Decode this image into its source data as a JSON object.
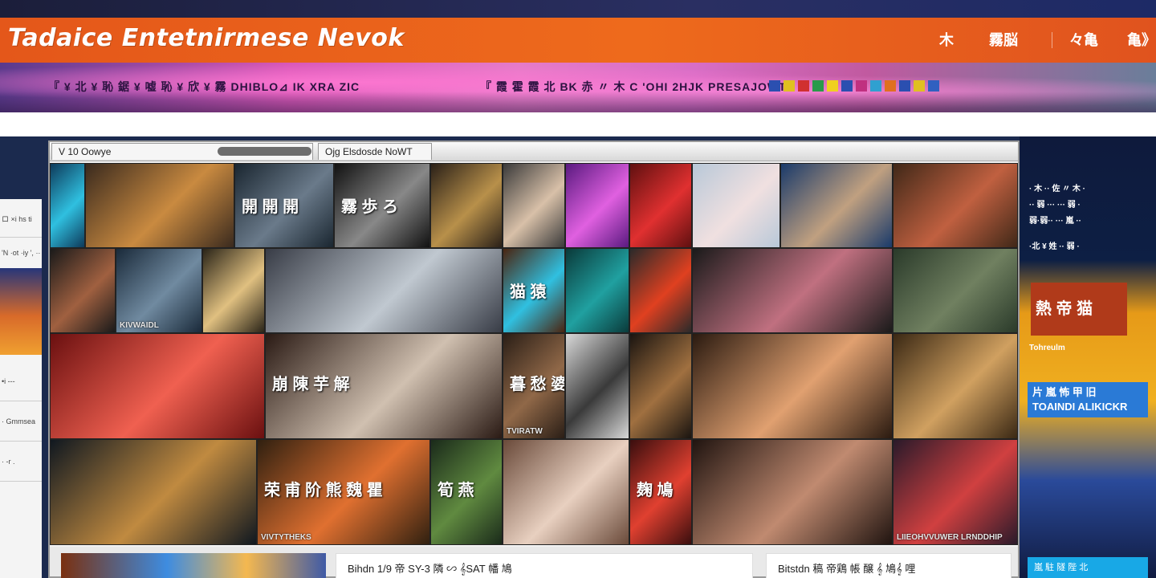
{
  "header": {
    "title": "Tadaice  Entetnirmese Nevok",
    "nav": [
      {
        "label": "木",
        "icon": "star-icon"
      },
      {
        "label": "霧脳",
        "icon": null
      },
      {
        "label": "々亀",
        "icon": null
      },
      {
        "label": "亀》",
        "icon": null
      }
    ]
  },
  "banner": {
    "text_left": "『 ¥ 北 ¥ 恥 鋸 ¥ 嘘 恥 ¥ 欣 ¥ 霧 DHIBLO⊿ IK XRA ZIC",
    "text_right": "『 霞 霍 霞 北 BK 赤 〃 木 C 'OHI 2HJK PRESAJOWT",
    "flag_colors": [
      "#2b4fb0",
      "#e0c020",
      "#d03030",
      "#2a9a4a",
      "#f0d020",
      "#2b4fb0",
      "#c03080",
      "#30a0d0",
      "#e07020",
      "#2b4fb0",
      "#e0c020",
      "#3060c0"
    ]
  },
  "left_panel": {
    "items": [
      "ロ ×i hs ti",
      "'N ·ot ·iy ', ··",
      "•i  ---",
      "·  Gmmsea",
      "·  -r  ."
    ]
  },
  "window": {
    "tabs": [
      {
        "label": "V  10   Oowye"
      },
      {
        "label": "Ojg  Elsdosde NoWT"
      }
    ],
    "progress": 0.78,
    "tiles": [
      {
        "caption": "",
        "big": "",
        "colors": [
          "#0e3a5a",
          "#2fc0e0"
        ]
      },
      {
        "caption": "",
        "big": "",
        "colors": [
          "#3a2a1e",
          "#c98a40"
        ]
      },
      {
        "caption": "",
        "big": "開 開 開",
        "colors": [
          "#1a2630",
          "#6a7a8a"
        ]
      },
      {
        "caption": "",
        "big": "霧 歩 ろ",
        "colors": [
          "#111",
          "#888"
        ]
      },
      {
        "caption": "",
        "big": "",
        "colors": [
          "#2a2018",
          "#b8904a"
        ]
      },
      {
        "caption": "",
        "big": "",
        "colors": [
          "#3a3a3a",
          "#d8c0a8"
        ]
      },
      {
        "caption": "",
        "big": "",
        "colors": [
          "#5a1a80",
          "#e060e0"
        ]
      },
      {
        "caption": "",
        "big": "",
        "colors": [
          "#601010",
          "#e03030"
        ]
      },
      {
        "caption": "",
        "big": "",
        "colors": [
          "#b8c8d8",
          "#f0e0e0"
        ]
      },
      {
        "caption": "",
        "big": "",
        "colors": [
          "#1a3a6a",
          "#c0a080"
        ]
      },
      {
        "caption": "",
        "big": "",
        "colors": [
          "#402818",
          "#c06040"
        ]
      },
      {
        "caption": "",
        "big": "",
        "colors": [
          "#1a1a1a",
          "#a06040"
        ]
      },
      {
        "caption": "KIVWAIDL",
        "big": "",
        "colors": [
          "#1a2a3a",
          "#708aa0"
        ]
      },
      {
        "caption": "",
        "big": "",
        "colors": [
          "#2a2418",
          "#e0c080"
        ]
      },
      {
        "caption": "",
        "big": "",
        "colors": [
          "#383c46",
          "#c0c8d0"
        ]
      },
      {
        "caption": "",
        "big": "猫 猿",
        "colors": [
          "#4a2410",
          "#30c0e0"
        ]
      },
      {
        "caption": "",
        "big": "",
        "colors": [
          "#0a3a3a",
          "#20a0a0"
        ]
      },
      {
        "caption": "",
        "big": "",
        "colors": [
          "#2a2a2a",
          "#e04020"
        ]
      },
      {
        "caption": "",
        "big": "",
        "colors": [
          "#1a1a1a",
          "#c07080"
        ]
      },
      {
        "caption": "",
        "big": "",
        "colors": [
          "#2a3a2a",
          "#708060"
        ]
      },
      {
        "caption": "",
        "big": "",
        "colors": [
          "#6a1010",
          "#f06050"
        ]
      },
      {
        "caption": "",
        "big": "崩 陳 芋 解",
        "colors": [
          "#2a1a14",
          "#d0c0b0"
        ]
      },
      {
        "caption": "TVIRATW",
        "big": "暮 愁 婆 輪 陳",
        "colors": [
          "#2a1e16",
          "#906848"
        ]
      },
      {
        "caption": "",
        "big": "",
        "colors": [
          "#d8d8d8",
          "#3a3a3a"
        ]
      },
      {
        "caption": "",
        "big": "",
        "colors": [
          "#1a1410",
          "#a07040"
        ]
      },
      {
        "caption": "",
        "big": "",
        "colors": [
          "#2a1a10",
          "#e0a070"
        ]
      },
      {
        "caption": "",
        "big": "",
        "colors": [
          "#3a2814",
          "#d0a060"
        ]
      },
      {
        "caption": "",
        "big": "",
        "colors": [
          "#101820",
          "#c08a40"
        ]
      },
      {
        "caption": "VIVTYTHEKS",
        "big": "荣 甫 阶 熊 魏 瞿",
        "colors": [
          "#302010",
          "#e07030"
        ]
      },
      {
        "caption": "",
        "big": "筍 燕",
        "colors": [
          "#1a2a1a",
          "#608a40"
        ]
      },
      {
        "caption": "",
        "big": "",
        "colors": [
          "#6a4a3a",
          "#e8d0c0"
        ]
      },
      {
        "caption": "",
        "big": "麹 鳩",
        "colors": [
          "#3a0e0e",
          "#e04030"
        ]
      },
      {
        "caption": "",
        "big": "",
        "colors": [
          "#201410",
          "#c08a70"
        ]
      },
      {
        "caption": "LIIEOHVVUWER LRNDDHIP",
        "big": "",
        "colors": [
          "#2a1a2a",
          "#d04040"
        ]
      },
      {
        "caption": "",
        "big": "",
        "colors": [
          "#2a2a2a",
          "#f0e0e0"
        ]
      }
    ],
    "cards": [
      {
        "label": ""
      },
      {
        "label": "Bihdn 1/9 帝 SY-3 隣  ∽ 𝄞SAT 幡 鳩"
      },
      {
        "label": "Bitstdn 稿 帝鶏 帳 醸 𝄞 鳩𝄞 哩"
      }
    ]
  },
  "right_ad": {
    "lines": [
      "· 木 ·· 佐 〃 木 ·",
      "·· 弱 ··· ··· 弱 ·",
      "弱·弱·· ··· 嵐 ··",
      "·北 ¥ 姓 ·· 弱 ·"
    ],
    "headline": "熱 帝 猫",
    "subline": "Tohreulm",
    "blue_button": "片 嵐 怖  甲 旧\nTOAINDI ALIKICKR",
    "bottom_button": "嵐 駐 隧 陛 北"
  }
}
